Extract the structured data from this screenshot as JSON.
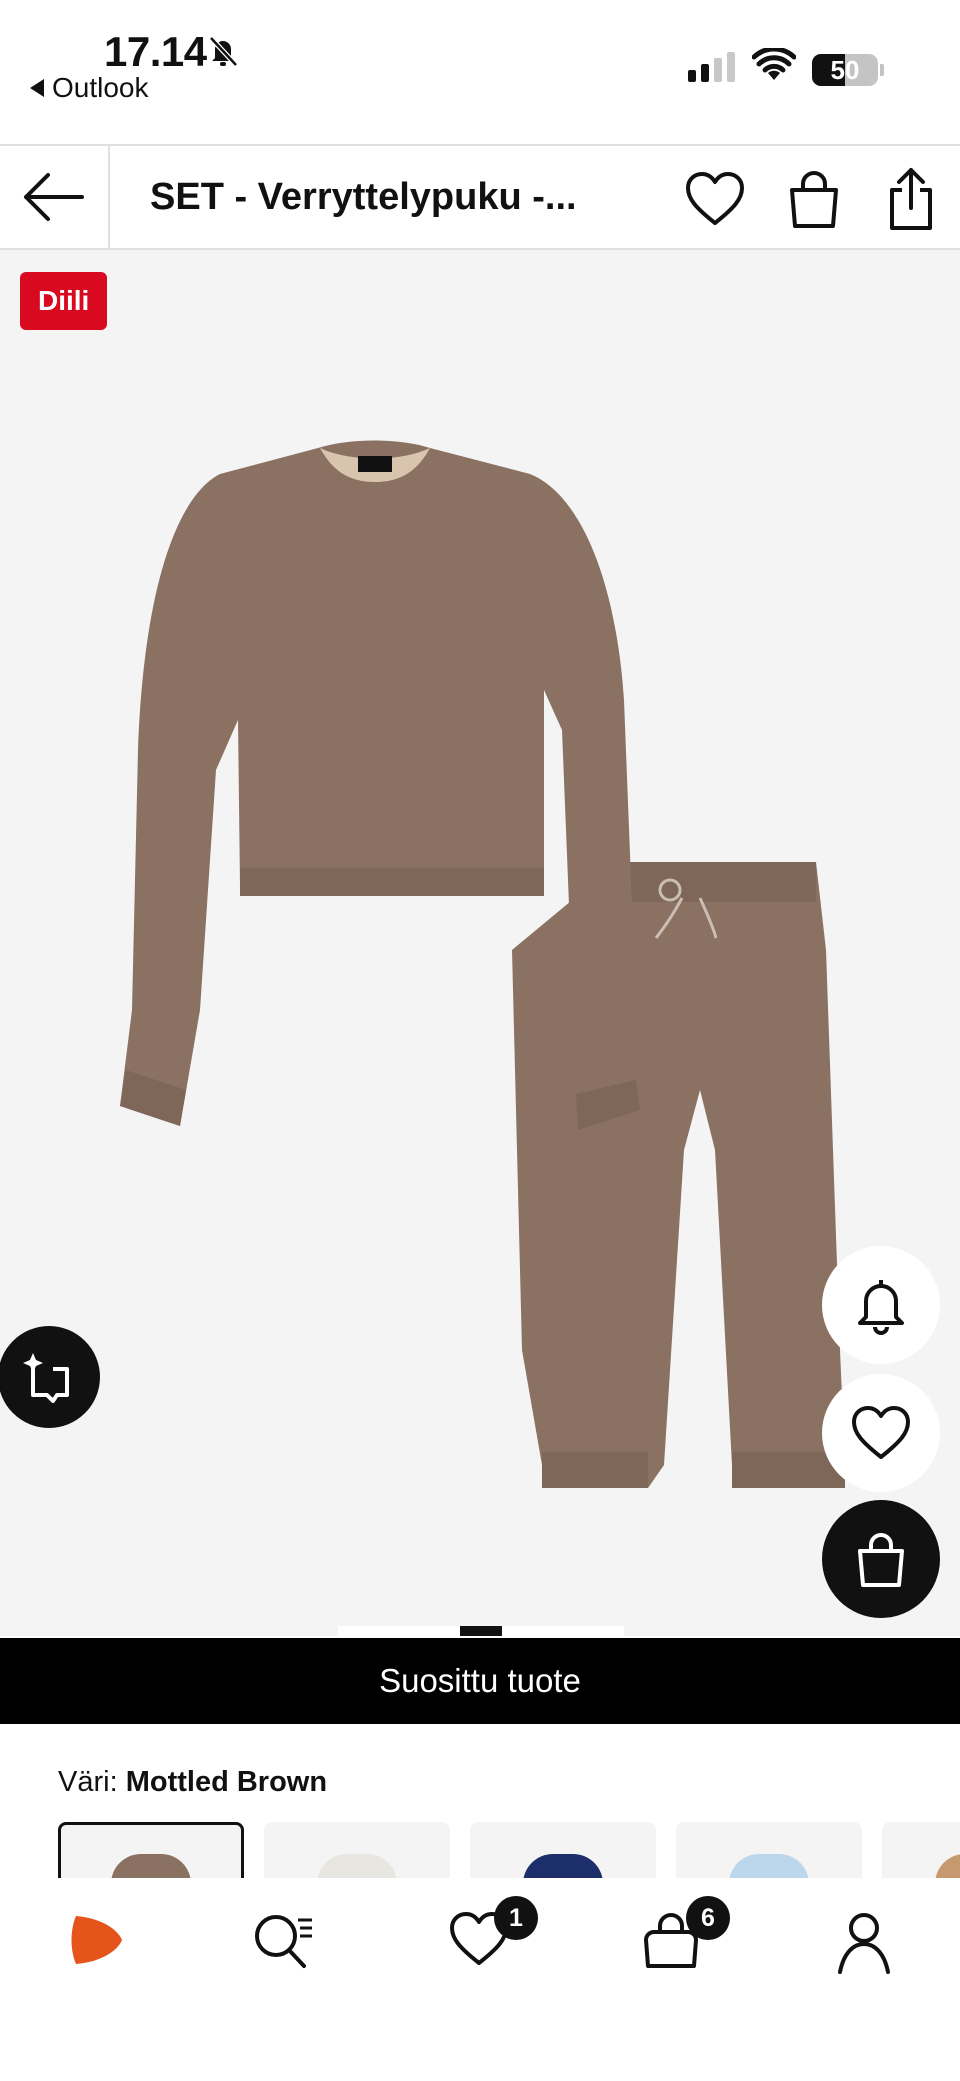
{
  "status_bar": {
    "time": "17.14",
    "back_app": "Outlook",
    "battery": "50",
    "icons": [
      "bell-off-icon",
      "signal-icon",
      "wifi-icon",
      "battery-icon"
    ]
  },
  "header": {
    "title": "SET - Verryttelypuku -...",
    "icons": [
      "back-arrow-icon",
      "heart-icon",
      "bag-icon",
      "share-icon"
    ]
  },
  "product": {
    "deal_badge": "Diili",
    "image_alt": "Brown sweatshirt and jogger set",
    "image_count": 5,
    "active_image": 3,
    "floating_buttons": [
      "ai-assistant-icon",
      "bell-icon",
      "heart-icon",
      "bag-icon"
    ],
    "popular_banner": "Suosittu tuote"
  },
  "color": {
    "label": "Väri:",
    "value": "Mottled Brown",
    "swatches": [
      {
        "name": "Mottled Brown",
        "selected": true,
        "color": "#8a7162"
      },
      {
        "name": "",
        "selected": false,
        "color": "#e8e6e1"
      },
      {
        "name": "",
        "selected": false,
        "color": "#1d2f6b"
      },
      {
        "name": "",
        "selected": false,
        "color": "#bcd6ec"
      },
      {
        "name": "",
        "selected": false,
        "color": "#c69a6e"
      }
    ]
  },
  "tab_bar": {
    "items": [
      {
        "icon": "zalando-logo-icon"
      },
      {
        "icon": "search-list-icon"
      },
      {
        "icon": "heart-icon",
        "badge": "1"
      },
      {
        "icon": "bag-icon",
        "badge": "6"
      },
      {
        "icon": "profile-icon"
      }
    ]
  },
  "colors": {
    "deal_red": "#d9091f",
    "brand_orange": "#e5541b",
    "product_bg": "#f4f4f5",
    "fabric": "#8a7162"
  }
}
